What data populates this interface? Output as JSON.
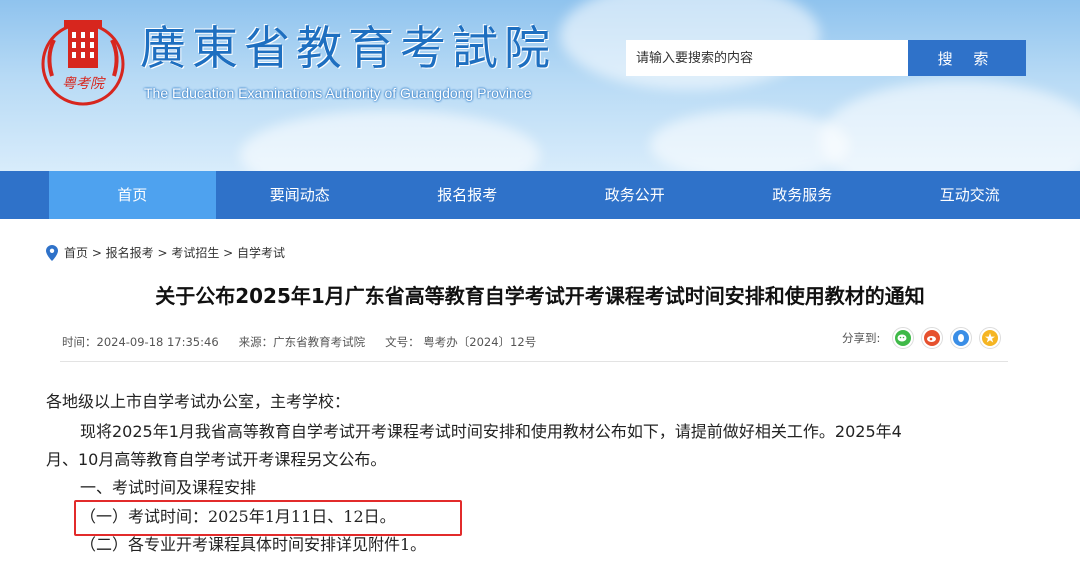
{
  "header": {
    "site_name": "廣東省教育考試院",
    "site_name_en": "The Education Examinations Authority of Guangdong Province",
    "seal_text": "粤考院"
  },
  "search": {
    "placeholder": "请输入要搜索的内容",
    "button_label": "搜 索"
  },
  "nav": {
    "items": [
      {
        "label": "首页"
      },
      {
        "label": "要闻动态"
      },
      {
        "label": "报名报考"
      },
      {
        "label": "政务公开"
      },
      {
        "label": "政务服务"
      },
      {
        "label": "互动交流"
      }
    ],
    "active_index": 0
  },
  "breadcrumb": {
    "text": "首页 > 报名报考 > 考试招生 > 自学考试"
  },
  "article": {
    "title": "关于公布2025年1月广东省高等教育自学考试开考课程考试时间安排和使用教材的通知",
    "time": "时间：2024-09-18 17:35:46",
    "source": "来源：广东省教育考试院",
    "doc_no": "文号： 粤考办〔2024〕12号",
    "share_label": "分享到:",
    "paragraphs": {
      "p1": "各地级以上市自学考试办公室，主考学校：",
      "p2a": "现将2025年1月我省高等教育自学考试开考课程考试时间安排和使用教材公布如下，请提前做好相关工作。2025年4",
      "p2b": "月、10月高等教育自学考试开考课程另文公布。",
      "p3": "一、考试时间及课程安排",
      "p4": "（一）考试时间：2025年1月11日、12日。",
      "p5": "（二）各专业开考课程具体时间安排详见附件1。"
    }
  },
  "colors": {
    "nav_bg": "#2f72c9",
    "nav_active": "#4ea2ef",
    "highlight": "#e22b2b",
    "brand": "#1e6fc0"
  }
}
